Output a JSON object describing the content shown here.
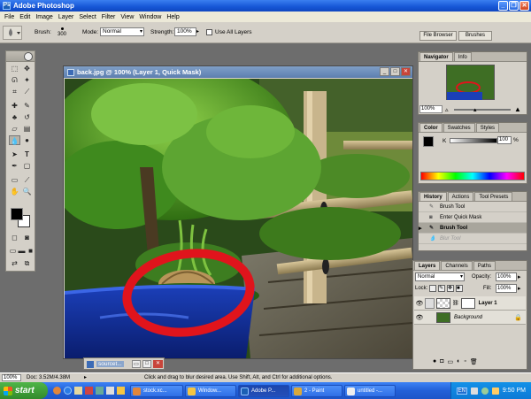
{
  "app": {
    "title": "Adobe Photoshop"
  },
  "menu": [
    "File",
    "Edit",
    "Image",
    "Layer",
    "Select",
    "Filter",
    "View",
    "Window",
    "Help"
  ],
  "options": {
    "brush_label": "Brush:",
    "brush_size": "300",
    "mode_label": "Mode:",
    "mode_value": "Normal",
    "strength_label": "Strength:",
    "strength_value": "100%",
    "use_all_layers": "Use All Layers",
    "file_browser": "File Browser",
    "brushes": "Brushes"
  },
  "document": {
    "title": "back.jpg @ 100% (Layer 1, Quick Mask)"
  },
  "navigator": {
    "tabs": [
      "Navigator",
      "Info"
    ],
    "zoom": "100%"
  },
  "color": {
    "tabs": [
      "Color",
      "Swatches",
      "Styles"
    ],
    "k_label": "K",
    "k_value": "100",
    "k_pct": "%"
  },
  "history": {
    "tabs": [
      "History",
      "Actions",
      "Tool Presets"
    ],
    "items": [
      "Brush Tool",
      "Enter Quick Mask",
      "Brush Tool",
      "Blur Tool"
    ]
  },
  "layers": {
    "tabs": [
      "Layers",
      "Channels",
      "Paths"
    ],
    "blend": "Normal",
    "opacity_label": "Opacity:",
    "opacity": "100%",
    "lock_label": "Lock:",
    "fill_label": "Fill:",
    "fill": "100%",
    "items": [
      "Layer 1",
      "Background"
    ]
  },
  "minimized": {
    "label": "sourcet..."
  },
  "status": {
    "zoom": "100%",
    "doc": "Doc: 3.52M/4.38M",
    "hint": "Click and drag to blur desired area. Use Shift, Alt, and Ctrl for additional options."
  },
  "taskbar": {
    "start": "start",
    "items": [
      "stock.xc...",
      "Window...",
      "Adobe P...",
      "2 - Paint",
      "untitled -..."
    ],
    "lang": "EN",
    "time": "9:50 PM"
  }
}
